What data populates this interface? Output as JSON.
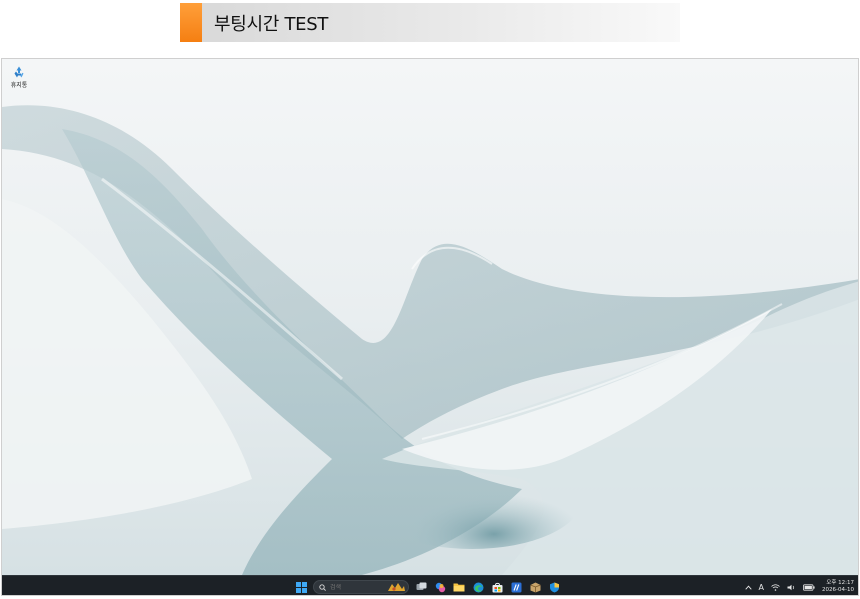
{
  "banner": {
    "title": "부팅시간 TEST",
    "accent_color": "#f58a1f"
  },
  "desktop": {
    "icons": [
      {
        "label": "휴지통",
        "icon": "recycle-bin-icon"
      }
    ]
  },
  "taskbar": {
    "start_icon": "windows-start-icon",
    "search": {
      "placeholder": "검색",
      "icon": "search-icon"
    },
    "pinned": [
      "widget-decoration-icon",
      "task-view-icon",
      "copilot-icon",
      "file-explorer-icon",
      "edge-icon",
      "microsoft-store-icon",
      "app-icon",
      "package-icon",
      "defender-icon"
    ],
    "tray": {
      "overflow_icon": "chevron-up-icon",
      "ime_label": "A",
      "icons": [
        "wifi-icon",
        "volume-icon",
        "battery-icon"
      ],
      "clock": {
        "time": "오후 12:17",
        "date": "2026-04-10"
      }
    },
    "colors": {
      "background": "#1c2126",
      "text": "#e6e6e6"
    }
  }
}
